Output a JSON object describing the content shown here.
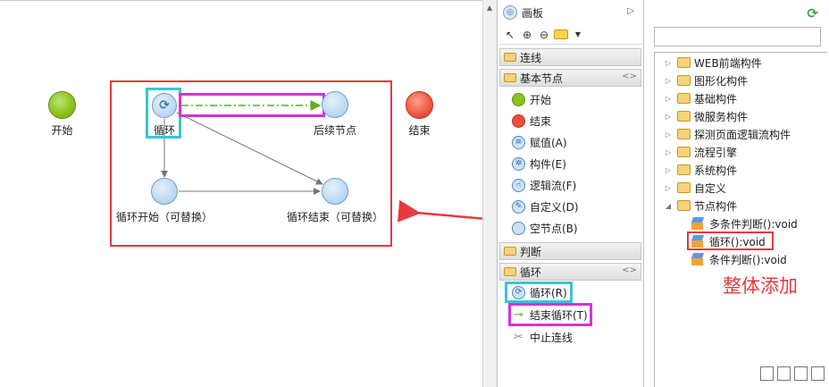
{
  "canvas": {
    "start_label": "开始",
    "end_label": "结束",
    "loop_label": "循环",
    "next_label": "后续节点",
    "loop_start_label": "循环开始（可替换）",
    "loop_end_label": "循环结束（可替换）"
  },
  "palette": {
    "title": "画板",
    "drawers": {
      "connection": "连线",
      "basic": "基本节点",
      "judge": "判断",
      "loop": "循环"
    },
    "basic_items": [
      {
        "label": "开始",
        "icon": "start-node-icon"
      },
      {
        "label": "结束",
        "icon": "end-node-icon"
      },
      {
        "label": "赋值(A)",
        "icon": "assign-icon"
      },
      {
        "label": "构件(E)",
        "icon": "component-icon"
      },
      {
        "label": "逻辑流(F)",
        "icon": "logic-flow-icon"
      },
      {
        "label": "自定义(D)",
        "icon": "custom-icon"
      },
      {
        "label": "空节点(B)",
        "icon": "empty-node-icon"
      }
    ],
    "loop_items": [
      {
        "label": "循环(R)",
        "icon": "loop-icon"
      },
      {
        "label": "结束循环(T)",
        "icon": "end-loop-icon"
      },
      {
        "label": "中止连线",
        "icon": "stop-link-icon"
      }
    ]
  },
  "tree": {
    "folders": [
      "WEB前端构件",
      "图形化构件",
      "基础构件",
      "微服务构件",
      "探测页面逻辑流构件",
      "流程引擎",
      "系统构件",
      "自定义",
      "节点构件"
    ],
    "children": [
      "多条件判断():void",
      "循环():void",
      "条件判断():void"
    ]
  },
  "annotation": "整体添加",
  "colors": {
    "highlight_red": "#e8393d",
    "highlight_cyan": "#39c5d3",
    "highlight_magenta": "#d633d6",
    "dashed_link_green": "#5fae1e"
  }
}
